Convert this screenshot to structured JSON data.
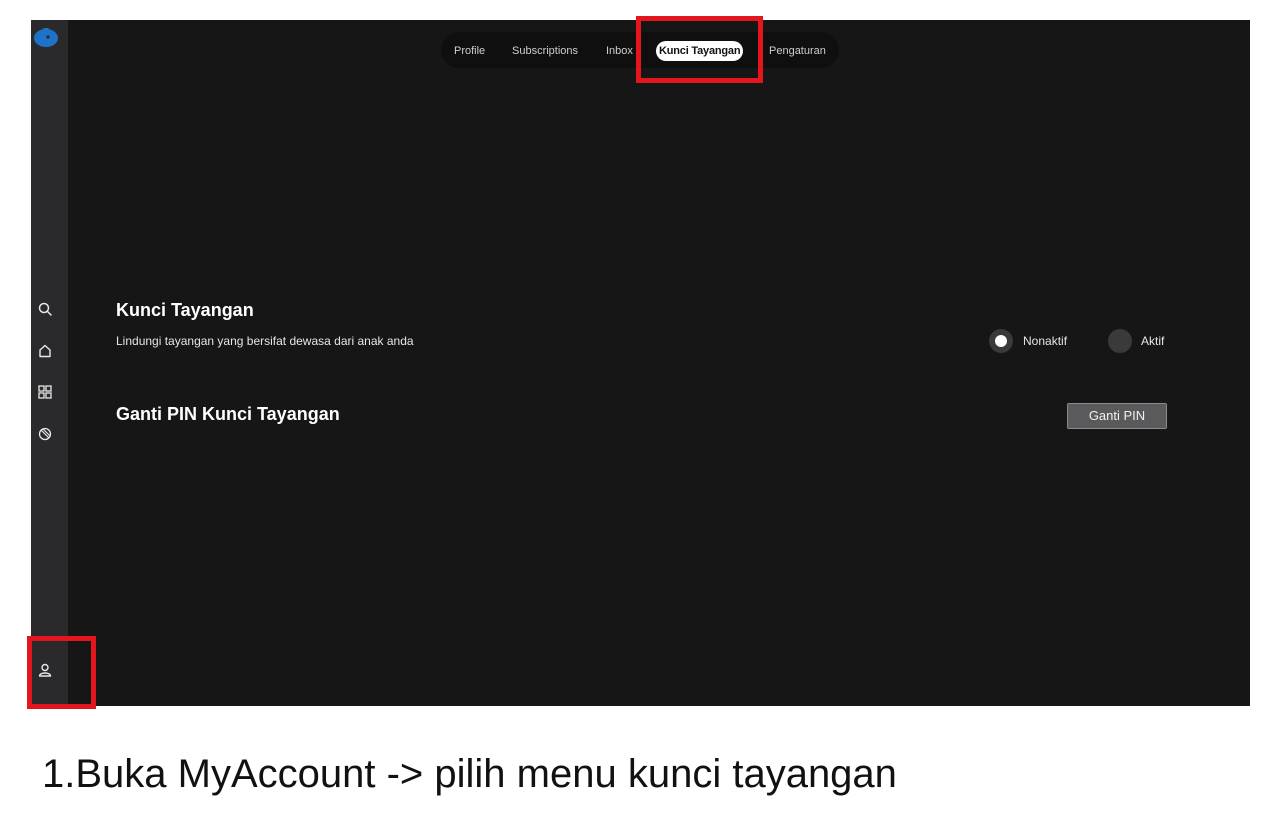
{
  "sidebar": {
    "logo_icon": "app-logo-icon",
    "icons": [
      "search-icon",
      "home-icon",
      "grid-icon",
      "sports-icon"
    ],
    "account_icon": "user-icon"
  },
  "topnav": {
    "tabs": [
      {
        "label": "Profile"
      },
      {
        "label": "Subscriptions"
      },
      {
        "label": "Inbox"
      },
      {
        "label": "Kunci Tayangan"
      },
      {
        "label": "Pengaturan"
      }
    ],
    "active_index": 3
  },
  "kunci": {
    "title": "Kunci Tayangan",
    "description": "Lindungi tayangan yang bersifat dewasa dari anak anda",
    "options": [
      {
        "label": "Nonaktif",
        "selected": true
      },
      {
        "label": "Aktif",
        "selected": false
      }
    ]
  },
  "pin": {
    "title": "Ganti PIN Kunci Tayangan",
    "button_label": "Ganti PIN"
  },
  "caption": "1.Buka MyAccount -> pilih menu kunci tayangan",
  "colors": {
    "background": "#161616",
    "sidebar": "#2a2a2c",
    "highlight": "#e3161d",
    "logo": "#1e73c8"
  }
}
